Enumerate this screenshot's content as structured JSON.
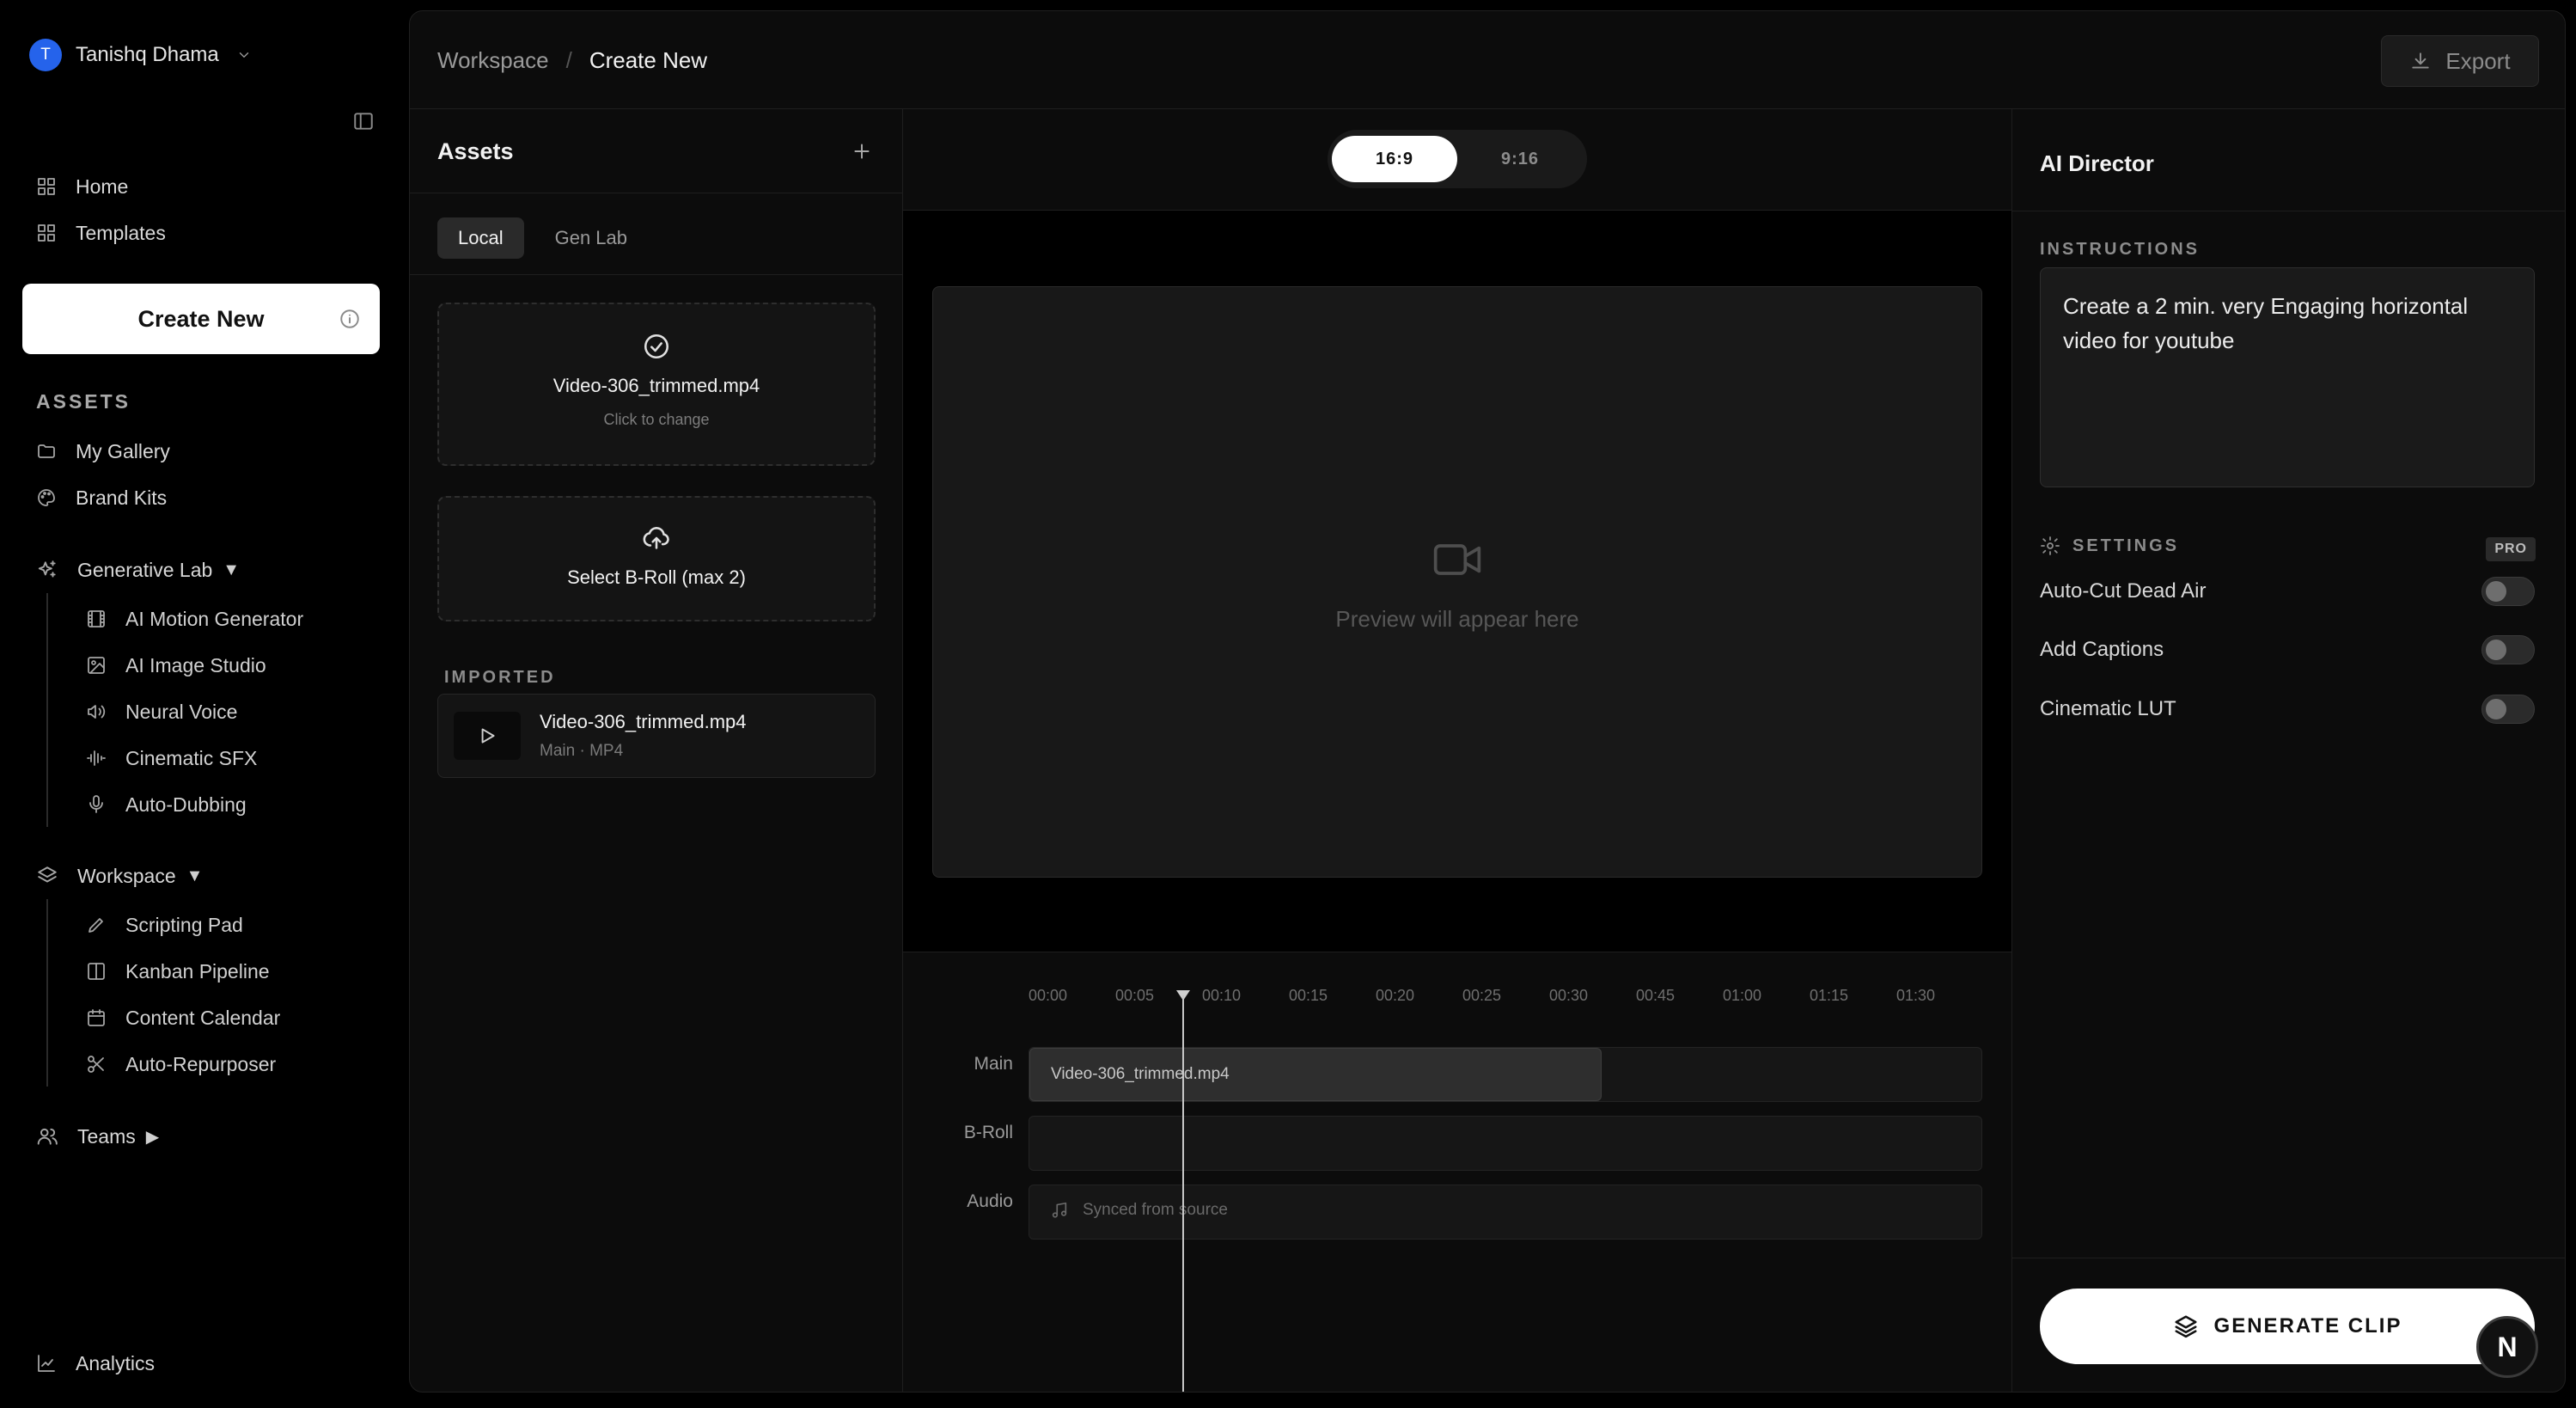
{
  "user": {
    "initial": "T",
    "name": "Tanishq Dhama"
  },
  "nav": {
    "home": "Home",
    "templates": "Templates"
  },
  "create_new": "Create New",
  "assets_section": {
    "label": "ASSETS",
    "items": [
      "My Gallery",
      "Brand Kits"
    ]
  },
  "generative_lab": {
    "label": "Generative Lab",
    "caret": "▼",
    "items": [
      "AI Motion Generator",
      "AI Image Studio",
      "Neural Voice",
      "Cinematic SFX",
      "Auto-Dubbing"
    ]
  },
  "workspace": {
    "label": "Workspace",
    "caret": "▼",
    "items": [
      "Scripting Pad",
      "Kanban Pipeline",
      "Content Calendar",
      "Auto-Repurposer"
    ]
  },
  "teams": {
    "label": "Teams",
    "caret": "▶"
  },
  "analytics": "Analytics",
  "breadcrumb": {
    "parent": "Workspace",
    "separator": "/",
    "current": "Create New"
  },
  "export_label": "Export",
  "assets_panel": {
    "title": "Assets",
    "tabs": [
      "Local",
      "Gen Lab"
    ],
    "main_upload": {
      "name": "Video-306_trimmed.mp4",
      "sub": "Click to change"
    },
    "broll_upload": {
      "label": "Select B-Roll (max 2)"
    },
    "imported_label": "IMPORTED",
    "imported": [
      {
        "name": "Video-306_trimmed.mp4",
        "meta": "Main · MP4"
      }
    ]
  },
  "ratio": {
    "options": [
      "16:9",
      "9:16"
    ],
    "selected": "16:9"
  },
  "preview_text": "Preview will appear here",
  "timeline": {
    "ticks": [
      "00:00",
      "00:05",
      "00:10",
      "00:15",
      "00:20",
      "00:25",
      "00:30",
      "00:45",
      "01:00",
      "01:15",
      "01:30"
    ],
    "tracks": {
      "main": "Main",
      "broll": "B-Roll",
      "audio": "Audio"
    },
    "main_clip": "Video-306_trimmed.mp4",
    "audio_text": "Synced from source"
  },
  "director": {
    "title": "AI Director",
    "instructions_label": "INSTRUCTIONS",
    "instructions": "Create a 2 min. very Engaging horizontal video for youtube",
    "settings_label": "SETTINGS",
    "pro_badge": "PRO",
    "settings": [
      {
        "label": "Auto-Cut Dead Air",
        "on": false
      },
      {
        "label": "Add Captions",
        "on": false
      },
      {
        "label": "Cinematic LUT",
        "on": false
      }
    ],
    "generate_label": "GENERATE CLIP"
  },
  "badge_letter": "N",
  "colors": {
    "avatar": "#2563eb",
    "background": "#000000",
    "panel": "#0c0c0c"
  }
}
